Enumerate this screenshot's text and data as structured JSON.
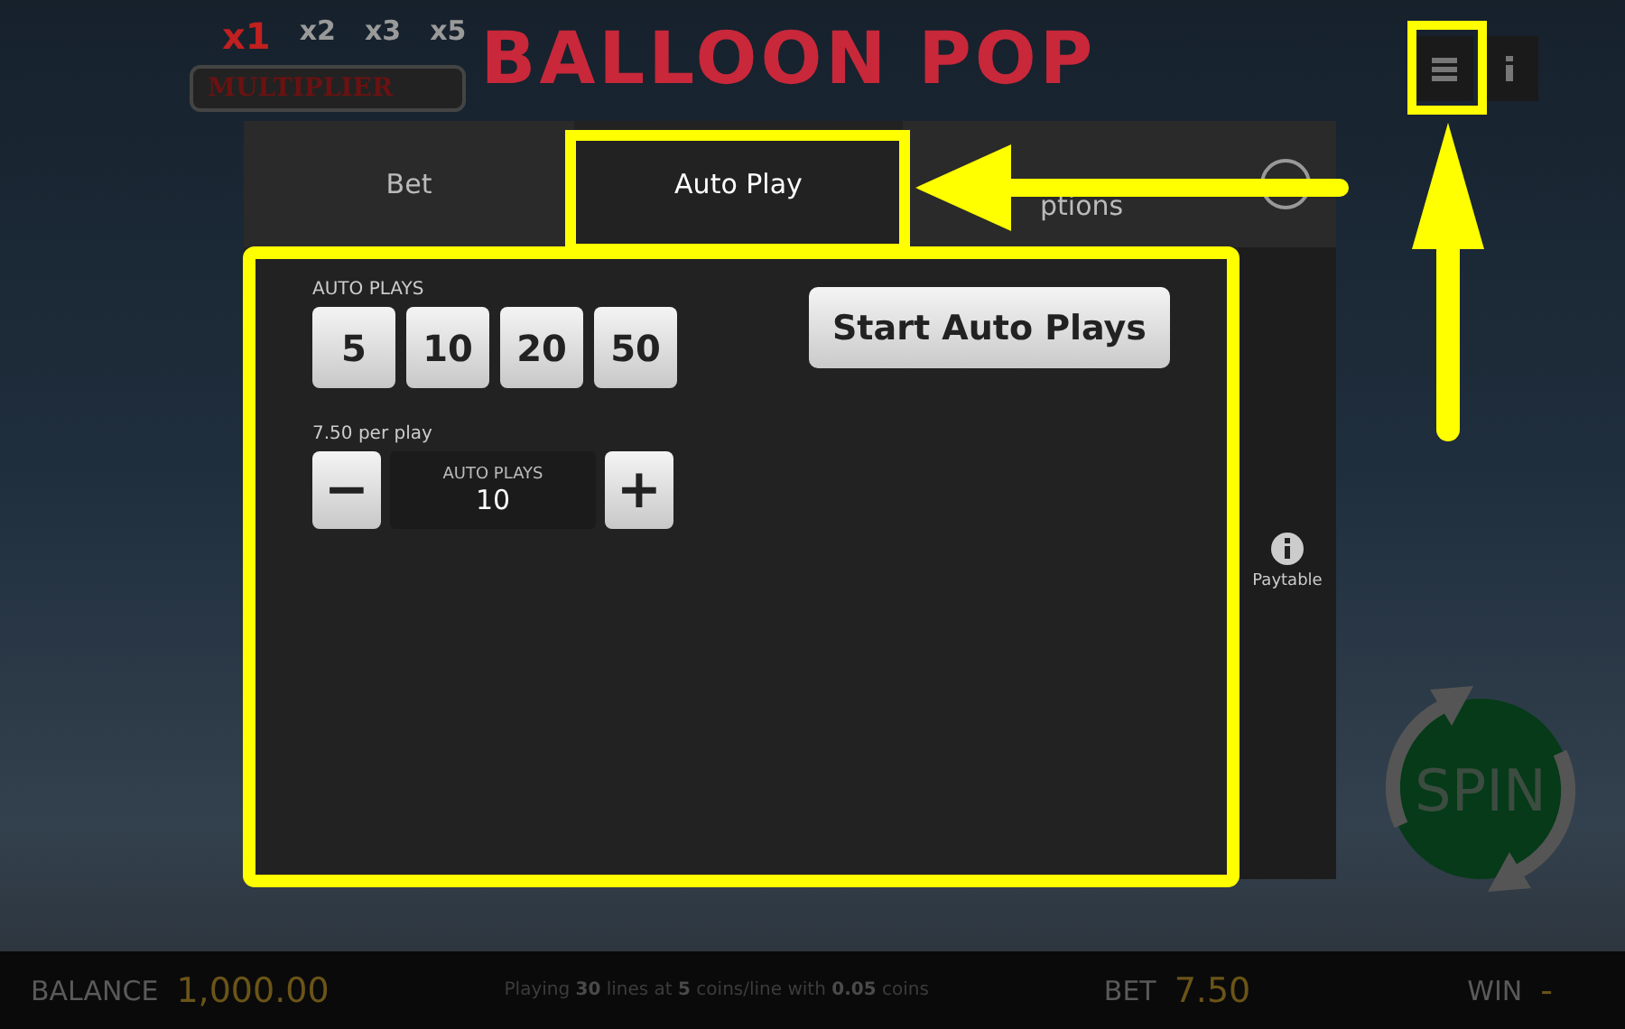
{
  "logo": {
    "title": "BALLOON POP",
    "badge": "MULTIPLIER",
    "multipliers": [
      "x1",
      "x2",
      "x3",
      "x5"
    ]
  },
  "tabs": [
    {
      "label": "Bet",
      "selected": false
    },
    {
      "label": "Auto Play",
      "selected": true
    },
    {
      "label": "ptions",
      "selected": false
    }
  ],
  "auto_play": {
    "presets_label": "AUTO PLAYS",
    "presets": [
      "5",
      "10",
      "20",
      "50"
    ],
    "start_button": "Start Auto Plays",
    "per_play": "7.50 per play",
    "stepper": {
      "minus": "−",
      "label": "AUTO PLAYS",
      "value": "10",
      "plus": "+"
    }
  },
  "side": {
    "paytable": "Paytable"
  },
  "spin": {
    "label": "SPIN"
  },
  "status_bar": {
    "balance_label": "BALANCE",
    "balance": "1,000.00",
    "info": "Playing **30** lines at **5** coins/line with **0.05** coins",
    "bet_label": "BET",
    "bet": "7.50",
    "win_label": "WIN",
    "win": "-"
  }
}
